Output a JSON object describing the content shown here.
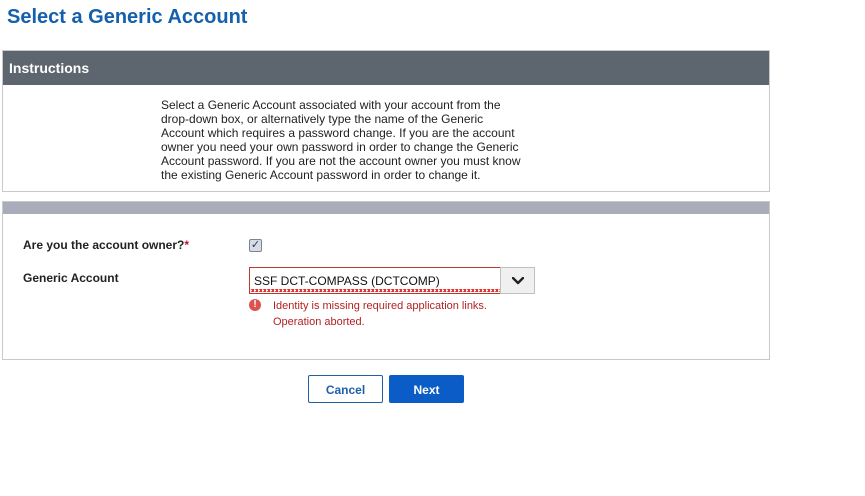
{
  "page": {
    "title": "Select a Generic Account"
  },
  "instructions": {
    "header": "Instructions",
    "text": "Select a Generic Account associated with your account from the\ndrop-down box, or alternatively type the name of the Generic\nAccount which requires a password change. If you are the account\nowner you need your own password in order to change the Generic\nAccount password. If you are not the account owner you must know\nthe existing Generic Account password in order to change it."
  },
  "form": {
    "owner_label": "Are you the account owner?",
    "required_marker": "*",
    "owner_checked": true,
    "checkbox_glyph": "✓",
    "generic_account_label": "Generic Account",
    "generic_account_value": "SSF DCT-COMPASS (DCTCOMP)",
    "error_icon_glyph": "!",
    "error_message": "Identity is missing required application links.\nOperation aborted."
  },
  "actions": {
    "cancel_label": "Cancel",
    "next_label": "Next"
  },
  "colors": {
    "title": "#1560ad",
    "instructions_header_bg": "#5d666e",
    "form_header_bar": "#a9adbb",
    "error": "#b22222",
    "primary_button": "#0b5cc6"
  },
  "icons": {
    "dropdown": "chevron-down-icon",
    "error": "error-circle-icon",
    "checkbox": "checkmark-icon"
  }
}
